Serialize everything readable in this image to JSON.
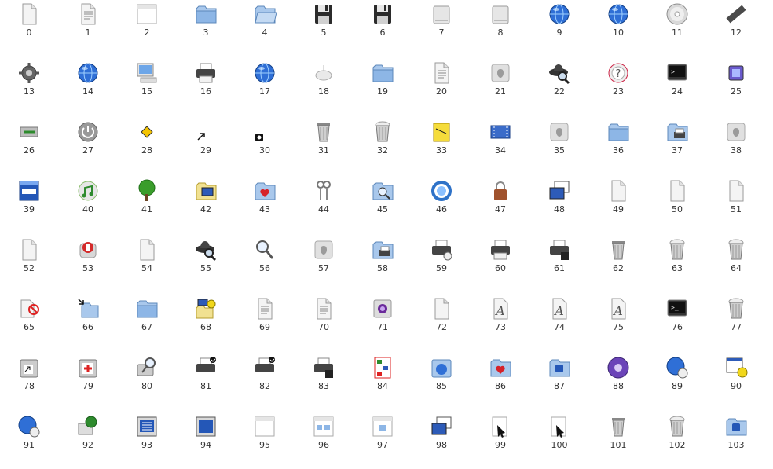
{
  "labels": [
    "0",
    "1",
    "2",
    "3",
    "4",
    "5",
    "6",
    "7",
    "8",
    "9",
    "10",
    "11",
    "12",
    "13",
    "14",
    "15",
    "16",
    "17",
    "18",
    "19",
    "20",
    "21",
    "22",
    "23",
    "24",
    "25",
    "26",
    "27",
    "28",
    "29",
    "30",
    "31",
    "32",
    "33",
    "34",
    "35",
    "36",
    "37",
    "38",
    "39",
    "40",
    "41",
    "42",
    "43",
    "44",
    "45",
    "46",
    "47",
    "48",
    "49",
    "50",
    "51",
    "52",
    "53",
    "54",
    "55",
    "56",
    "57",
    "58",
    "59",
    "60",
    "61",
    "62",
    "63",
    "64",
    "65",
    "66",
    "67",
    "68",
    "69",
    "70",
    "71",
    "72",
    "73",
    "74",
    "75",
    "76",
    "77",
    "78",
    "79",
    "80",
    "81",
    "82",
    "83",
    "84",
    "85",
    "86",
    "87",
    "88",
    "89",
    "90",
    "91",
    "92",
    "93",
    "94",
    "95",
    "96",
    "97",
    "98",
    "99",
    "100",
    "101",
    "102",
    "103"
  ],
  "icons": [
    "document-icon",
    "text-document-icon",
    "window-icon",
    "folder-icon",
    "folder-open-icon",
    "floppy-disk-icon",
    "floppy-disk-icon",
    "hard-drive-icon",
    "hard-drive-icon",
    "globe-icon",
    "globe-warning-icon",
    "cd-icon",
    "ram-chip-icon",
    "gear-icon",
    "globe-speaker-icon",
    "computer-icon",
    "printer-icon",
    "globe-icon",
    "mouse-icon",
    "folder-icon",
    "document-clock-icon",
    "apple-app-icon",
    "magnifier-hat-icon",
    "help-lifebuoy-icon",
    "terminal-icon",
    "cube-icon",
    "network-icon",
    "power-icon",
    "warning-sign-icon",
    "alias-arrow-icon",
    "small-badge-icon",
    "trash-icon",
    "trash-full-icon",
    "notepad-icon",
    "film-strip-icon",
    "apple-app-icon",
    "folder-icon",
    "folder-printer-icon",
    "apple-app-icon",
    "options-window-icon",
    "music-icon",
    "tree-icon",
    "folder-computer-icon",
    "folder-heart-icon",
    "keys-icon",
    "folder-search-icon",
    "sync-icon",
    "lock-icon",
    "window-stack-icon",
    "blank-icon",
    "blank-icon",
    "blank-icon",
    "blank-icon",
    "stop-hand-icon",
    "document-icon",
    "magnifier-hat-icon",
    "magnifier-icon",
    "apple-app-icon",
    "folder-printer-icon",
    "printer-clock-icon",
    "printer-icon",
    "printer-disk-icon",
    "trash-icon",
    "trash-full-icon",
    "trash-full-icon",
    "document-forbidden-icon",
    "folders-arrow-icon",
    "folder-icon",
    "folder-gear-icon",
    "text-document-icon",
    "text-document-icon",
    "camera-icon",
    "document-icon",
    "font-icon",
    "font-icon",
    "font-icon",
    "terminal-icon",
    "trash-full-icon",
    "disk-alias-icon",
    "first-aid-icon",
    "disk-search-icon",
    "printer-check-icon",
    "printer-check-icon",
    "printer-disk-check-icon",
    "flowchart-icon",
    "globe-window-icon",
    "folder-heart-icon",
    "folder-app-icon",
    "cd-purple-icon",
    "globe-clock-icon",
    "window-gear-icon",
    "globe-clock-icon",
    "network-computer-icon",
    "window-list-icon",
    "window-screen-icon",
    "window-icon",
    "window-folders-icon",
    "window-folder-icon",
    "window-stack-icon",
    "cursor-busy-icon",
    "cursor-busy-icon",
    "trash-icon",
    "trash-full-icon",
    "folder-app-icon"
  ],
  "colors": {
    "label": "#333333",
    "rule": "#9fb3c6"
  }
}
